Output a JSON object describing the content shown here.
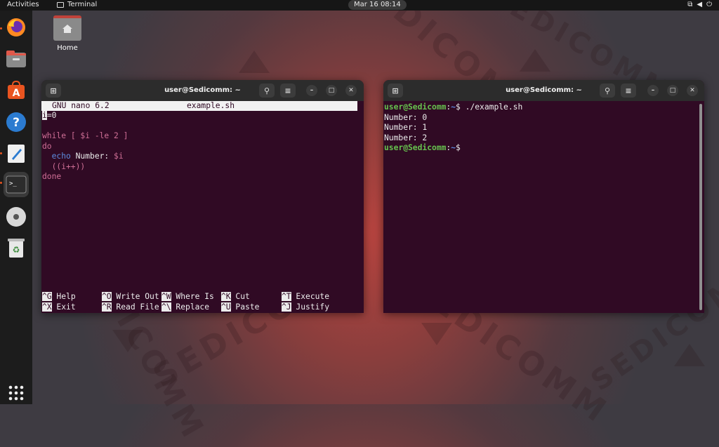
{
  "topbar": {
    "activities": "Activities",
    "app_name": "Terminal",
    "clock": "Mar 16  08:14",
    "tray_network_icon": "network-icon",
    "tray_volume_icon": "volume-icon",
    "tray_power_icon": "power-icon"
  },
  "dock": {
    "items": [
      "firefox",
      "files",
      "software-center",
      "help",
      "text-editor",
      "terminal",
      "disc",
      "trash",
      "show-apps"
    ]
  },
  "desktop": {
    "home_label": "Home"
  },
  "left_window": {
    "title": "user@Sedicomm: ~",
    "nano_header_left": "GNU nano 6.2",
    "nano_header_file": "example.sh",
    "lines": {
      "l1": "i=0",
      "l3_while": "while",
      "l3_bracket_open": " [ ",
      "l3_var": "$i",
      "l3_rest": " -le 2 ]",
      "l4": "do",
      "l5_echo": "  echo",
      "l5_text": " Number: ",
      "l5_var": "$i",
      "l6": "  ((i++))",
      "l7": "done"
    },
    "shortcuts": [
      {
        "key": "^G",
        "label": "Help"
      },
      {
        "key": "^O",
        "label": "Write Out"
      },
      {
        "key": "^W",
        "label": "Where Is"
      },
      {
        "key": "^K",
        "label": "Cut"
      },
      {
        "key": "^T",
        "label": "Execute"
      },
      {
        "key": "^X",
        "label": "Exit"
      },
      {
        "key": "^R",
        "label": "Read File"
      },
      {
        "key": "^\\",
        "label": "Replace"
      },
      {
        "key": "^U",
        "label": "Paste"
      },
      {
        "key": "^J",
        "label": "Justify"
      }
    ]
  },
  "right_window": {
    "title": "user@Sedicomm: ~",
    "prompt_user": "user@Sedicomm",
    "prompt_sep": ":",
    "prompt_path": "~",
    "command": "$ ./example.sh",
    "output": [
      "Number: 0",
      "Number: 1",
      "Number: 2"
    ],
    "prompt_end": "$"
  },
  "colors": {
    "terminal_bg": "#300a24",
    "prompt_green": "#66c24e",
    "prompt_blue": "#5b86d9",
    "ubuntu_orange": "#e95420"
  }
}
